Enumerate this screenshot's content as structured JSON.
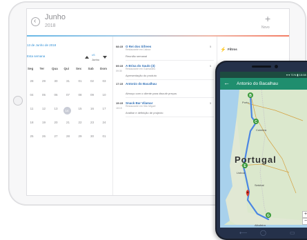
{
  "tablet": {
    "header": {
      "month": "Junho",
      "year": "2018",
      "plus": "+",
      "new_label": "Novo",
      "back": "‹"
    },
    "calendar": {
      "selected_date": "13 de Junho de 2018",
      "week_label": "Esta semana",
      "view_label": "xS",
      "month_label": "Junho",
      "weekdays": [
        "Dom",
        "Seg",
        "Ter",
        "Qua",
        "Qui",
        "Sex",
        "Sab"
      ],
      "weekdays_shown": [
        "Seg",
        "Ter",
        "Qua",
        "Qui",
        "Sex",
        "Sab",
        "Dom"
      ],
      "rows": [
        [
          "28",
          "29",
          "30",
          "31",
          "01",
          "02",
          "03"
        ],
        [
          "04",
          "05",
          "06",
          "07",
          "08",
          "09",
          "10"
        ],
        [
          "11",
          "12",
          "13",
          "14",
          "15",
          "16",
          "17"
        ],
        [
          "18",
          "19",
          "20",
          "21",
          "22",
          "23",
          "24"
        ],
        [
          "25",
          "26",
          "27",
          "28",
          "29",
          "30",
          "01"
        ]
      ],
      "today": "14"
    },
    "events": [
      {
        "time": "08:15",
        "time2": "",
        "title": "O Rei dos Sifrees",
        "sub": "Restaurante em Lisboa",
        "desc": "Reunião semanal",
        "count": "5"
      },
      {
        "time": "09:15",
        "time2": "09:30",
        "title": "A Brisa do Saulo (3)",
        "sub": "Restaurante em Guimarães",
        "desc": "Apresentação do produto",
        "count": "5"
      },
      {
        "time": "17:15",
        "time2": "",
        "title": "Antonio do Bacalhau",
        "sub": "",
        "desc": "Almoço com o cliente para discutir preços",
        "count": ""
      },
      {
        "time": "15:15",
        "time2": "18:15",
        "title": "Snack Bar Vilamar",
        "sub": "Restaurante em São Miguel",
        "desc": "Análise e definição de projecto",
        "count": "5"
      }
    ],
    "filters": {
      "label": "Filtros",
      "icon": "⚡",
      "check": "✓"
    }
  },
  "phone": {
    "status": "▾ ▾ 71% ▮ 15:08",
    "title": "Antonio do Bacalhau",
    "back": "←",
    "map": {
      "country": "Portugal",
      "markers": [
        "B",
        "C",
        "E",
        "F",
        "G"
      ],
      "places": [
        "Porto",
        "Coimbra",
        "Lisboa",
        "Albufeira",
        "Setúbal"
      ],
      "zoom_in": "+",
      "zoom_out": "−"
    },
    "nav": {
      "back": "⟵",
      "home": "◯",
      "recent": "▭"
    }
  }
}
